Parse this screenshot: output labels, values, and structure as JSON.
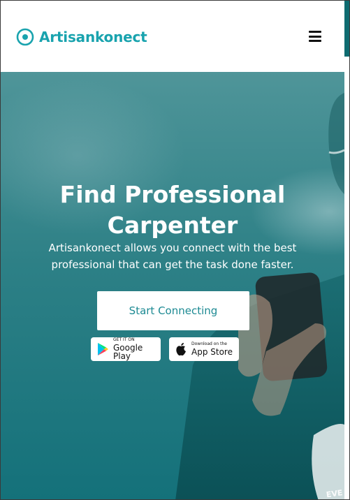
{
  "brand": {
    "name": "Artisankonect",
    "color": "#19a3ae"
  },
  "header": {
    "menu_icon": "hamburger-menu-icon"
  },
  "hero": {
    "title": "Find Professional Carpenter",
    "subtitle": "Artisankonect allows you connect with the best professional that can get the task done faster.",
    "cta_label": "Start Connecting",
    "overlay_color": "#14717a"
  },
  "stores": {
    "google": {
      "small": "GET IT ON",
      "big": "Google Play",
      "icon": "google-play-icon"
    },
    "apple": {
      "small": "Download on the",
      "big": "App Store",
      "icon": "apple-icon"
    }
  }
}
